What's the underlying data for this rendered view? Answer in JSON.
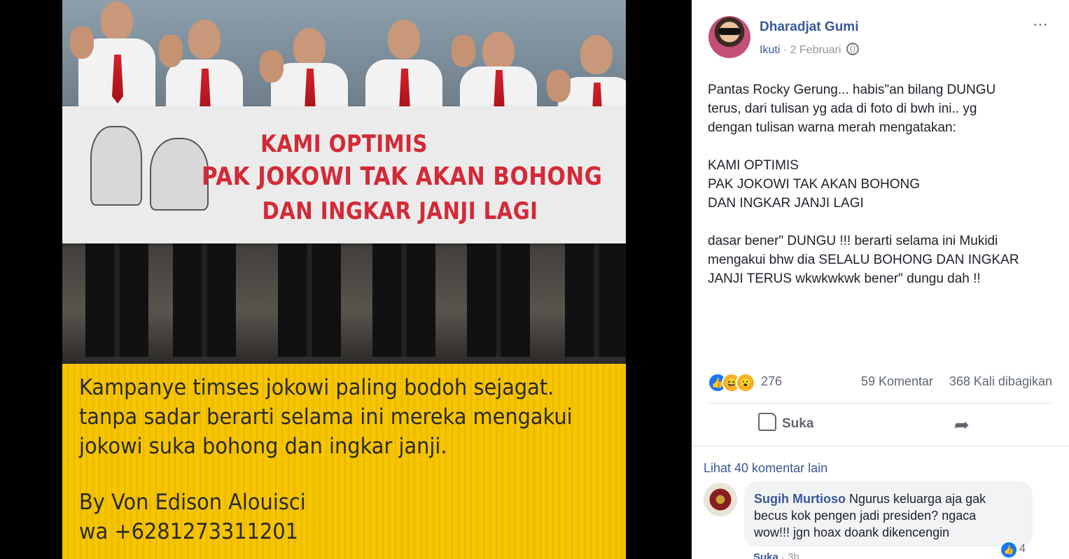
{
  "photo": {
    "banner_lines": [
      "KAMI OPTIMIS",
      "PAK JOKOWI TAK AKAN BOHONG",
      "DAN INGKAR JANJI LAGI"
    ],
    "caption_lines": [
      "Kampanye timses jokowi paling bodoh sejagat.",
      "tanpa sadar berarti selama ini mereka mengakui",
      "jokowi suka bohong dan ingkar janji."
    ],
    "credit_lines": [
      "By Von Edison Alouisci",
      "wa +6281273311201"
    ]
  },
  "post": {
    "author": "Dharadjat Gumi",
    "follow_label": "Ikuti",
    "separator": " · ",
    "date": "2 Februari",
    "more_icon": "⋯",
    "text_lines": [
      "Pantas Rocky Gerung... habis\"an bilang DUNGU",
      "terus, dari tulisan yg ada di foto di bwh ini.. yg",
      "dengan tulisan warna merah mengatakan:",
      "",
      "KAMI OPTIMIS",
      "PAK JOKOWI TAK AKAN BOHONG",
      "DAN INGKAR JANJI LAGI",
      "",
      "dasar bener\" DUNGU !!! berarti selama ini Mukidi",
      "mengakui bhw dia SELALU BOHONG DAN INGKAR",
      "JANJI TERUS wkwkwkwk bener\" dungu dah !!"
    ],
    "reaction_icons": [
      "like-icon",
      "haha-icon",
      "wow-icon"
    ],
    "reaction_count": "276",
    "comment_count": "59 Komentar",
    "share_count": "368 Kali dibagikan",
    "like_label": "Suka",
    "share_icon": "share-arrow-icon"
  },
  "comments": {
    "more_label": "Lihat 40 komentar lain",
    "items": [
      {
        "name": "Sugih Murtioso",
        "text": "Ngurus keluarga aja gak becus kok pengen jadi presiden? ngaca wow!!! jgn hoax doank dikencengin",
        "like_count": "4",
        "like_action": "Suka",
        "time": "3h"
      }
    ]
  },
  "colors": {
    "link": "#385898",
    "accent": "#1877f2",
    "caption_bg": "#f6c400",
    "banner_text": "#d32a37"
  }
}
